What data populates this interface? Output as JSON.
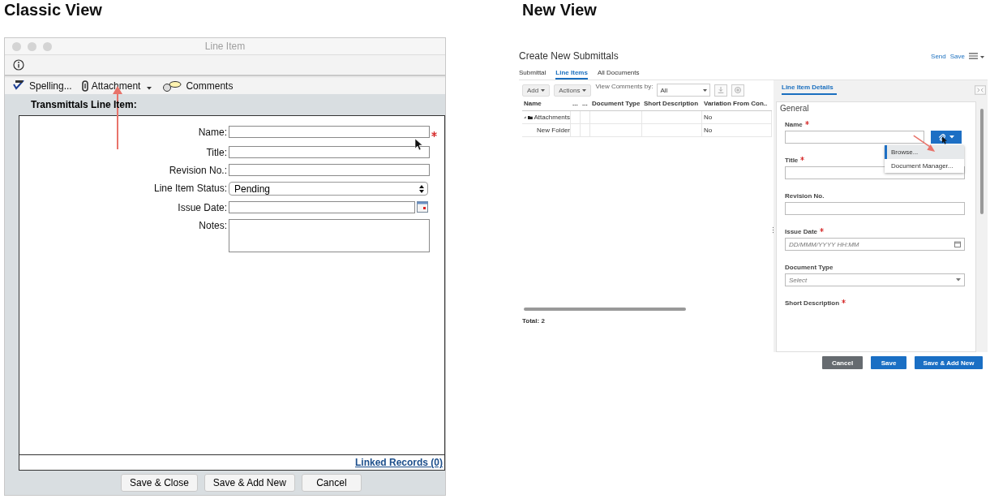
{
  "classic": {
    "heading": "Classic View",
    "window_title": "Line Item",
    "toolbar": [
      {
        "kind": "spelling",
        "label": "Spelling..."
      },
      {
        "kind": "attachment",
        "label": "Attachment"
      },
      {
        "kind": "comments",
        "label": "Comments"
      }
    ],
    "section_title": "Transmittals Line Item:",
    "fields": [
      {
        "kind": "text",
        "label": "Name:",
        "required": true
      },
      {
        "kind": "text",
        "label": "Title:",
        "required": false
      },
      {
        "kind": "text",
        "label": "Revision No.:",
        "required": false
      },
      {
        "kind": "select",
        "label": "Line Item Status:",
        "value": "Pending",
        "required": false
      },
      {
        "kind": "date",
        "label": "Issue Date:",
        "required": false
      },
      {
        "kind": "textarea",
        "label": "Notes:",
        "required": false
      }
    ],
    "link": "Linked Records (0)",
    "buttons": [
      "Save & Close",
      "Save & Add New",
      "Cancel"
    ]
  },
  "new": {
    "heading": "New View",
    "title": "Create New Submittals",
    "header_actions": [
      "Send",
      "Save"
    ],
    "tabs": [
      {
        "label": "Submittal",
        "selected": false
      },
      {
        "label": "Line Items",
        "selected": true
      },
      {
        "label": "All Documents",
        "selected": false
      }
    ],
    "toolbar": {
      "add": "Add",
      "actions": "Actions",
      "filter_label": "View Comments by:",
      "filter_value": "All"
    },
    "columns": [
      "Name",
      "...",
      "...",
      "Document Type",
      "Short Description",
      "Variation From Con.."
    ],
    "rows": [
      {
        "cells": [
          "Attachments",
          "",
          "",
          "",
          "",
          "No"
        ],
        "expanded": true,
        "children": [
          {
            "cells": [
              "New Folder",
              "",
              "",
              "",
              "",
              "No"
            ]
          }
        ]
      }
    ],
    "total": "Total: 2",
    "details": {
      "tab": "Line Item Details",
      "section": "General",
      "fields": [
        {
          "kind": "text",
          "label": "Name",
          "required": true,
          "attach": true
        },
        {
          "kind": "text",
          "label": "Title",
          "required": true
        },
        {
          "kind": "text",
          "label": "Revision No.",
          "required": false
        },
        {
          "kind": "date",
          "label": "Issue Date",
          "required": true,
          "placeholder": "DD/MMM/YYYY HH:MM"
        },
        {
          "kind": "select",
          "label": "Document Type",
          "required": false,
          "placeholder": "Select"
        },
        {
          "kind": "label",
          "label": "Short Description",
          "required": true
        }
      ],
      "menu": [
        {
          "label": "Browse...",
          "selected": true
        },
        {
          "label": "Document Manager...",
          "selected": false
        }
      ],
      "buttons": [
        {
          "kind": "secondary",
          "label": "Cancel"
        },
        {
          "kind": "primary",
          "label": "Save"
        },
        {
          "kind": "primary",
          "label": "Save & Add New"
        }
      ]
    }
  }
}
